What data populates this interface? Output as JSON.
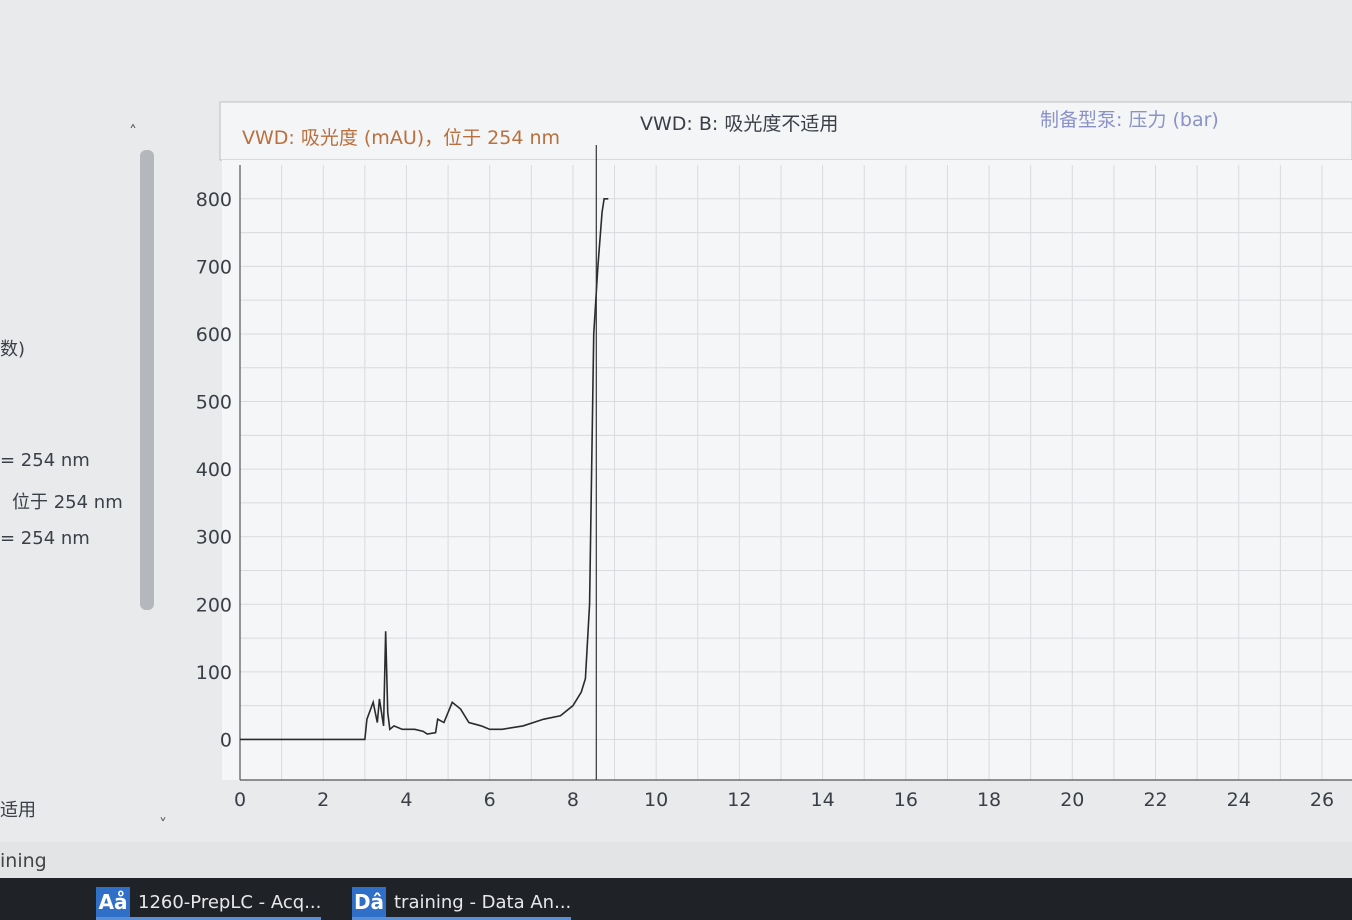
{
  "left_panel": {
    "labels": [
      "数)",
      "= 254 nm",
      "位于 254 nm",
      "= 254 nm",
      "适用"
    ]
  },
  "chart": {
    "headers": {
      "signal_a": "VWD: 吸光度 (mAU)，位于 254 nm",
      "signal_b": "VWD: B: 吸光度不适用",
      "pump": "制备型泵: 压力 (bar)"
    },
    "colors": {
      "signal_a": "#b9703e",
      "signal_b": "#3a3f47",
      "pump": "#8a92c8",
      "trace": "#2b2b2b"
    }
  },
  "chart_data": {
    "type": "line",
    "x_ticks": [
      0,
      2,
      4,
      6,
      8,
      10,
      12,
      14,
      16,
      18,
      20,
      22,
      24,
      26
    ],
    "y_ticks": [
      0,
      100,
      200,
      300,
      400,
      500,
      600,
      700,
      800
    ],
    "xlim": [
      0,
      26
    ],
    "ylim": [
      -60,
      850
    ],
    "grid": true,
    "series": [
      {
        "name": "VWD: 吸光度 (mAU)，位于 254 nm",
        "x": [
          0,
          2,
          3,
          3.05,
          3.2,
          3.3,
          3.35,
          3.45,
          3.5,
          3.55,
          3.6,
          3.7,
          3.9,
          4.2,
          4.4,
          4.5,
          4.7,
          4.75,
          4.9,
          5.0,
          5.1,
          5.3,
          5.5,
          5.8,
          6.0,
          6.3,
          6.8,
          7.3,
          7.7,
          8.0,
          8.2,
          8.3,
          8.4,
          8.45,
          8.5,
          8.55,
          8.6,
          8.7,
          8.75,
          8.85
        ],
        "y": [
          0,
          0,
          0,
          30,
          55,
          25,
          60,
          20,
          160,
          40,
          15,
          20,
          15,
          15,
          12,
          8,
          10,
          30,
          25,
          40,
          55,
          45,
          25,
          20,
          15,
          15,
          20,
          30,
          35,
          50,
          70,
          90,
          200,
          400,
          600,
          650,
          700,
          780,
          800,
          800
        ]
      }
    ]
  },
  "status_text": "ining",
  "taskbar": {
    "items": [
      {
        "icon": "Aå",
        "label": "1260-PrepLC - Acq..."
      },
      {
        "icon": "Dâ",
        "label": "training - Data An..."
      }
    ]
  }
}
